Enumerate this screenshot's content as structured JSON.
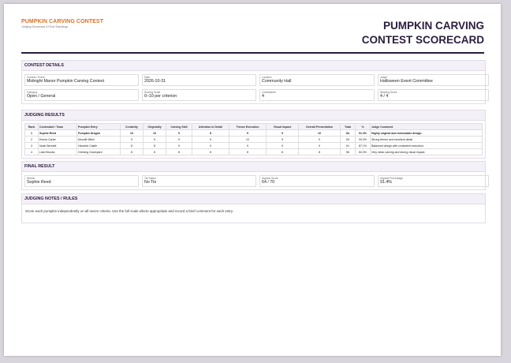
{
  "header": {
    "brand": "PUMPKIN CARVING CONTEST",
    "subtitle": "Judging Scorecard & Final Standings",
    "title_line1": "PUMPKIN CARVING",
    "title_line2": "CONTEST SCORECARD"
  },
  "details": {
    "heading": "CONTEST DETAILS",
    "row1": [
      {
        "label": "Contest / Event",
        "value": "Midnight Manor Pumpkin Carving Contest"
      },
      {
        "label": "Date",
        "value": "2026-10-31"
      },
      {
        "label": "Location",
        "value": "Community Hall"
      },
      {
        "label": "Judge",
        "value": "Halloween Event Committee"
      }
    ],
    "row2": [
      {
        "label": "Category",
        "value": "Open / General"
      },
      {
        "label": "Scoring Scale",
        "value": "0–10 per criterion"
      },
      {
        "label": "Contestants",
        "value": "4"
      },
      {
        "label": "Winning Score",
        "value": "4 / 4"
      }
    ]
  },
  "results": {
    "heading": "JUDGING RESULTS",
    "columns": [
      "Rank",
      "Contestant / Team",
      "Pumpkin Entry",
      "Creativity",
      "Originality",
      "Carving Skill",
      "Attention to Detail",
      "Theme Execution",
      "Visual Impact",
      "Overall Presentation",
      "Total",
      "%",
      "Judge Comment"
    ],
    "rows": [
      [
        "1",
        "Sophie Reed",
        "Pumpkin Dragon",
        "10",
        "10",
        "9",
        "8",
        "9",
        "9",
        "10",
        "84",
        "91.4%",
        "Highly original and memorable design."
      ],
      [
        "2",
        "Emma Carter",
        "Moonlit Witch",
        "9",
        "9",
        "9",
        "9",
        "10",
        "9",
        "9",
        "63",
        "90.0%",
        "Strong theme and excellent detail."
      ],
      [
        "3",
        "Noah Bennett",
        "Haunted Castle",
        "8",
        "8",
        "9",
        "9",
        "9",
        "9",
        "9",
        "61",
        "87.1%",
        "Balanced design with consistent execution."
      ],
      [
        "4",
        "Liam Brooks",
        "Grinning Graveyard",
        "8",
        "8",
        "8",
        "8",
        "8",
        "8",
        "8",
        "56",
        "84.3%",
        "Very clean carving and strong visual impact."
      ]
    ]
  },
  "final": {
    "heading": "FINAL RESULT",
    "fields": [
      {
        "label": "Winner",
        "value": "Sophie Reed"
      },
      {
        "label": "Tie Status",
        "value": "No Tie"
      },
      {
        "label": "Highest Score",
        "value": "64 / 70"
      },
      {
        "label": "Highest Percentage",
        "value": "91.4%"
      }
    ]
  },
  "notes": {
    "heading": "JUDGING NOTES / RULES",
    "text": "Score each pumpkin independently on all seven criteria. Use the full scale where appropriate and record a brief comment for each entry."
  }
}
